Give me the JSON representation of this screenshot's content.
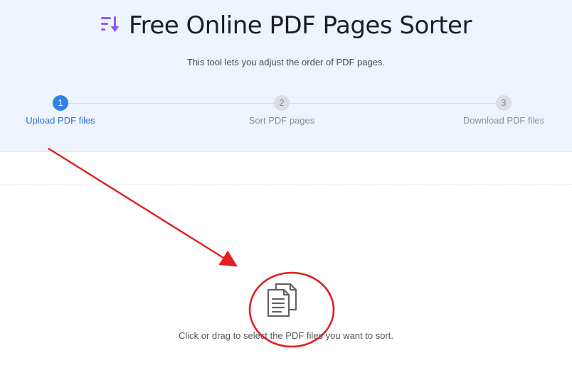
{
  "header": {
    "title": "Free Online PDF Pages Sorter",
    "subtitle": "This tool lets you adjust the order of PDF pages.",
    "icon": "sort-icon"
  },
  "steps": [
    {
      "number": "1",
      "label": "Upload PDF files",
      "active": true
    },
    {
      "number": "2",
      "label": "Sort PDF pages",
      "active": false
    },
    {
      "number": "3",
      "label": "Download PDF files",
      "active": false
    }
  ],
  "dropzone": {
    "icon": "documents-icon",
    "text": "Click or drag to select the PDF files you want to sort."
  },
  "colors": {
    "accent": "#2f80ed",
    "hero_bg": "#eef4fe",
    "title_icon": "#8b5cf6",
    "annotation": "#e02020"
  }
}
